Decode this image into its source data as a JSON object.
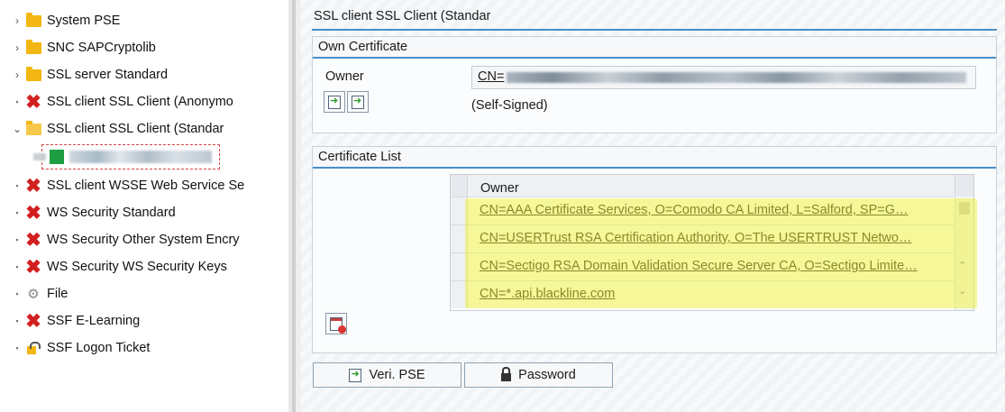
{
  "tree": {
    "items": [
      {
        "label": "System PSE",
        "icon": "folder-icon",
        "kind": "expandable"
      },
      {
        "label": "SNC SAPCryptolib",
        "icon": "folder-icon",
        "kind": "expandable"
      },
      {
        "label": "SSL server Standard",
        "icon": "folder-icon",
        "kind": "expandable"
      },
      {
        "label": "SSL client SSL Client (Anonymo",
        "icon": "red-x-icon",
        "kind": "leaf"
      },
      {
        "label": "SSL client SSL Client (Standar",
        "icon": "open-folder-icon",
        "kind": "expanded"
      },
      {
        "label": "SSL client WSSE Web Service Se",
        "icon": "red-x-icon",
        "kind": "leaf"
      },
      {
        "label": "WS Security Standard",
        "icon": "red-x-icon",
        "kind": "leaf"
      },
      {
        "label": "WS Security Other System Encry",
        "icon": "red-x-icon",
        "kind": "leaf"
      },
      {
        "label": "WS Security WS Security Keys",
        "icon": "red-x-icon",
        "kind": "leaf"
      },
      {
        "label": "File",
        "icon": "gear-icon",
        "kind": "leaf"
      },
      {
        "label": "SSF E-Learning",
        "icon": "red-x-icon",
        "kind": "leaf"
      },
      {
        "label": "SSF Logon Ticket",
        "icon": "ticket-lock-icon",
        "kind": "leaf"
      }
    ]
  },
  "pse": {
    "title": "SSL client SSL Client (Standar"
  },
  "own_certificate": {
    "title": "Own Certificate",
    "owner_label": "Owner",
    "owner_value_prefix": "CN=",
    "status": "(Self-Signed)"
  },
  "certificate_list": {
    "title": "Certificate List",
    "column_header": "Owner",
    "rows": [
      "CN=AAA Certificate Services, O=Comodo CA Limited, L=Salford, SP=G…",
      "CN=USERTrust RSA Certification Authority, O=The USERTRUST Netwo…",
      "CN=Sectigo RSA Domain Validation Secure Server CA, O=Sectigo Limite…",
      "CN=*.api.blackline.com"
    ]
  },
  "buttons": {
    "veri_pse": "Veri. PSE",
    "password": "Password"
  },
  "colors": {
    "accent_line": "#4a8fc8",
    "highlight": "#eef046",
    "error_x": "#d21f1f",
    "folder": "#f2b712"
  }
}
